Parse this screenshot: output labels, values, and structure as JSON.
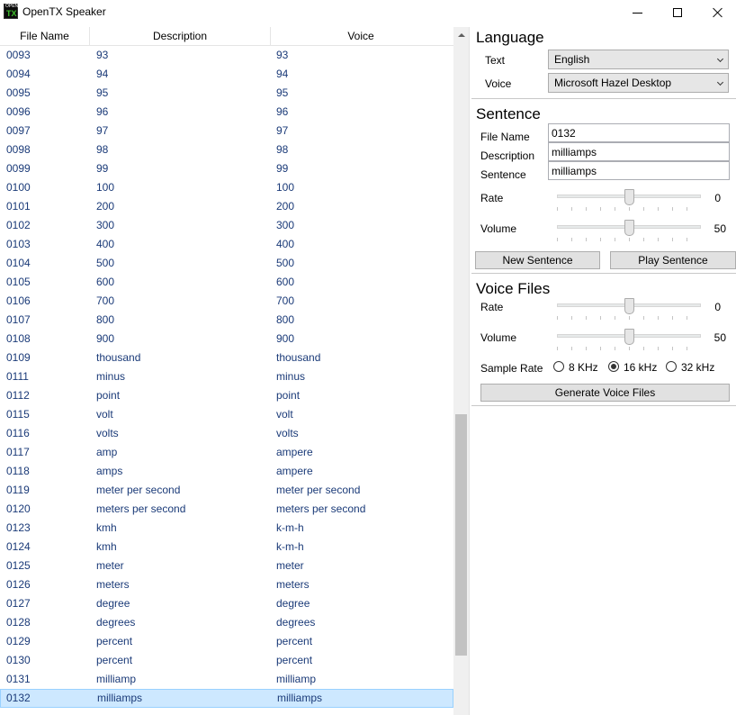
{
  "window": {
    "title": "OpenTX Speaker",
    "icon_top": "OPEN",
    "icon_bottom": "TX"
  },
  "list": {
    "columns": [
      "File Name",
      "Description",
      "Voice"
    ],
    "rows": [
      {
        "file": "0093",
        "desc": "93",
        "voice": "93"
      },
      {
        "file": "0094",
        "desc": "94",
        "voice": "94"
      },
      {
        "file": "0095",
        "desc": "95",
        "voice": "95"
      },
      {
        "file": "0096",
        "desc": "96",
        "voice": "96"
      },
      {
        "file": "0097",
        "desc": "97",
        "voice": "97"
      },
      {
        "file": "0098",
        "desc": "98",
        "voice": "98"
      },
      {
        "file": "0099",
        "desc": "99",
        "voice": "99"
      },
      {
        "file": "0100",
        "desc": "100",
        "voice": "100"
      },
      {
        "file": "0101",
        "desc": "200",
        "voice": "200"
      },
      {
        "file": "0102",
        "desc": "300",
        "voice": "300"
      },
      {
        "file": "0103",
        "desc": "400",
        "voice": "400"
      },
      {
        "file": "0104",
        "desc": "500",
        "voice": "500"
      },
      {
        "file": "0105",
        "desc": "600",
        "voice": "600"
      },
      {
        "file": "0106",
        "desc": "700",
        "voice": "700"
      },
      {
        "file": "0107",
        "desc": "800",
        "voice": "800"
      },
      {
        "file": "0108",
        "desc": "900",
        "voice": "900"
      },
      {
        "file": "0109",
        "desc": "thousand",
        "voice": "thousand"
      },
      {
        "file": "0111",
        "desc": "minus",
        "voice": "minus"
      },
      {
        "file": "0112",
        "desc": "point",
        "voice": "point"
      },
      {
        "file": "0115",
        "desc": "volt",
        "voice": "volt"
      },
      {
        "file": "0116",
        "desc": "volts",
        "voice": "volts"
      },
      {
        "file": "0117",
        "desc": "amp",
        "voice": "ampere"
      },
      {
        "file": "0118",
        "desc": "amps",
        "voice": "ampere"
      },
      {
        "file": "0119",
        "desc": "meter per second",
        "voice": "meter per second"
      },
      {
        "file": "0120",
        "desc": "meters per second",
        "voice": "meters per second"
      },
      {
        "file": "0123",
        "desc": "kmh",
        "voice": "k-m-h"
      },
      {
        "file": "0124",
        "desc": "kmh",
        "voice": "k-m-h"
      },
      {
        "file": "0125",
        "desc": "meter",
        "voice": "meter"
      },
      {
        "file": "0126",
        "desc": "meters",
        "voice": "meters"
      },
      {
        "file": "0127",
        "desc": "degree",
        "voice": "degree"
      },
      {
        "file": "0128",
        "desc": "degrees",
        "voice": "degrees"
      },
      {
        "file": "0129",
        "desc": "percent",
        "voice": "percent"
      },
      {
        "file": "0130",
        "desc": "percent",
        "voice": "percent"
      },
      {
        "file": "0131",
        "desc": "milliamp",
        "voice": "milliamp"
      },
      {
        "file": "0132",
        "desc": "milliamps",
        "voice": "milliamps",
        "selected": true
      }
    ]
  },
  "language": {
    "title": "Language",
    "text_label": "Text",
    "text_value": "English",
    "voice_label": "Voice",
    "voice_value": "Microsoft Hazel Desktop"
  },
  "sentence": {
    "title": "Sentence",
    "file_name_label": "File Name",
    "file_name_value": "0132",
    "description_label": "Description",
    "description_value": "milliamps",
    "sentence_label": "Sentence",
    "sentence_value": "milliamps",
    "rate_label": "Rate",
    "rate_value": "0",
    "volume_label": "Volume",
    "volume_value": "50",
    "new_button": "New Sentence",
    "play_button": "Play Sentence"
  },
  "voice_files": {
    "title": "Voice Files",
    "rate_label": "Rate",
    "rate_value": "0",
    "volume_label": "Volume",
    "volume_value": "50",
    "sample_rate_label": "Sample Rate",
    "sample_rates": [
      "8 KHz",
      "16 kHz",
      "32 kHz"
    ],
    "selected_sample_rate": "16 kHz",
    "generate_button": "Generate Voice Files"
  }
}
